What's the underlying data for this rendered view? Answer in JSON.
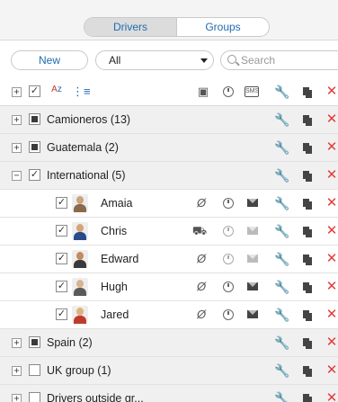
{
  "tabs": {
    "drivers": "Drivers",
    "groups": "Groups"
  },
  "toolbar": {
    "new_label": "New",
    "filter_value": "All",
    "search_placeholder": "Search"
  },
  "header": {
    "sort_icon": "A↓Z",
    "tree_icon": "tree-icon"
  },
  "groups": [
    {
      "label": "Camioneros (13)",
      "expanded": false,
      "check": "partial"
    },
    {
      "label": "Guatemala (2)",
      "expanded": false,
      "check": "partial"
    },
    {
      "label": "International (5)",
      "expanded": true,
      "check": "checked"
    },
    {
      "label": "Spain (2)",
      "expanded": false,
      "check": "partial"
    },
    {
      "label": "UK group (1)",
      "expanded": false,
      "check": "empty"
    },
    {
      "label": "Drivers outside gr...",
      "expanded": false,
      "check": "empty"
    }
  ],
  "drivers": [
    {
      "name": "Amaia",
      "status": "no-vehicle",
      "msg": "active"
    },
    {
      "name": "Chris",
      "status": "vehicle",
      "msg": "inactive"
    },
    {
      "name": "Edward",
      "status": "no-vehicle",
      "msg": "inactive"
    },
    {
      "name": "Hugh",
      "status": "no-vehicle",
      "msg": "active"
    },
    {
      "name": "Jared",
      "status": "no-vehicle",
      "msg": "active"
    }
  ],
  "colors": {
    "accent": "#1f6bb0",
    "delete": "#e23b3b",
    "group_bg": "#f0f0f0"
  }
}
